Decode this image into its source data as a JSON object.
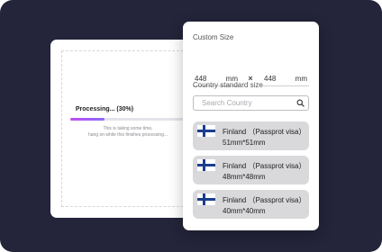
{
  "processing": {
    "title": "Processing... (30%)",
    "progress": 0.3,
    "message_line1": "This is taking some time,",
    "message_line2": "hang on while this finishes processing..."
  },
  "custom_size": {
    "label": "Custom Size",
    "width_value": "448",
    "width_unit": "mm",
    "separator": "×",
    "height_value": "448",
    "height_unit": "mm"
  },
  "country_standard": {
    "label": "Country standard size",
    "search_placeholder": "Search Country",
    "options": [
      {
        "name": "Finland （Passprot visa）",
        "size": "51mm*51mm",
        "flag": "finland-flag-icon"
      },
      {
        "name": "Finland （Passprot visa）",
        "size": "48mm*48mm",
        "flag": "finland-flag-icon"
      },
      {
        "name": "Finland （Passprot visa）",
        "size": "40mm*40mm",
        "flag": "finland-flag-icon"
      }
    ]
  },
  "colors": {
    "background": "#24243a",
    "progress_gradient_start": "#c04df0",
    "progress_gradient_end": "#8a6cf8",
    "option_background": "#d9d9db",
    "finland_blue": "#1b3e8c"
  }
}
